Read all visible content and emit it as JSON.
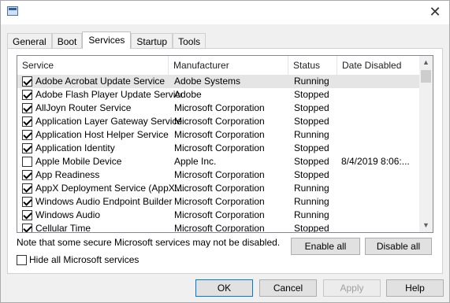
{
  "window": {
    "close_glyph": "✕"
  },
  "tabs": [
    {
      "label": "General"
    },
    {
      "label": "Boot"
    },
    {
      "label": "Services"
    },
    {
      "label": "Startup"
    },
    {
      "label": "Tools"
    }
  ],
  "columns": {
    "service": "Service",
    "manufacturer": "Manufacturer",
    "status": "Status",
    "date_disabled": "Date Disabled"
  },
  "services": [
    {
      "checked": true,
      "name": "Adobe Acrobat Update Service",
      "manufacturer": "Adobe Systems",
      "status": "Running",
      "date": ""
    },
    {
      "checked": true,
      "name": "Adobe Flash Player Update Service",
      "manufacturer": "Adobe",
      "status": "Stopped",
      "date": ""
    },
    {
      "checked": true,
      "name": "AllJoyn Router Service",
      "manufacturer": "Microsoft Corporation",
      "status": "Stopped",
      "date": ""
    },
    {
      "checked": true,
      "name": "Application Layer Gateway Service",
      "manufacturer": "Microsoft Corporation",
      "status": "Stopped",
      "date": ""
    },
    {
      "checked": true,
      "name": "Application Host Helper Service",
      "manufacturer": "Microsoft Corporation",
      "status": "Running",
      "date": ""
    },
    {
      "checked": true,
      "name": "Application Identity",
      "manufacturer": "Microsoft Corporation",
      "status": "Stopped",
      "date": ""
    },
    {
      "checked": false,
      "name": "Apple Mobile Device",
      "manufacturer": "Apple Inc.",
      "status": "Stopped",
      "date": "8/4/2019 8:06:..."
    },
    {
      "checked": true,
      "name": "App Readiness",
      "manufacturer": "Microsoft Corporation",
      "status": "Stopped",
      "date": ""
    },
    {
      "checked": true,
      "name": "AppX Deployment Service (AppX...",
      "manufacturer": "Microsoft Corporation",
      "status": "Running",
      "date": ""
    },
    {
      "checked": true,
      "name": "Windows Audio Endpoint Builder",
      "manufacturer": "Microsoft Corporation",
      "status": "Running",
      "date": ""
    },
    {
      "checked": true,
      "name": "Windows Audio",
      "manufacturer": "Microsoft Corporation",
      "status": "Running",
      "date": ""
    },
    {
      "checked": true,
      "name": "Cellular Time",
      "manufacturer": "Microsoft Corporation",
      "status": "Stopped",
      "date": ""
    }
  ],
  "note": "Note that some secure Microsoft services may not be disabled.",
  "enable_all": "Enable all",
  "disable_all": "Disable all",
  "hide_ms": "Hide all Microsoft services",
  "footer": {
    "ok": "OK",
    "cancel": "Cancel",
    "apply": "Apply",
    "help": "Help"
  },
  "scroll": {
    "up": "▲",
    "down": "▼"
  }
}
